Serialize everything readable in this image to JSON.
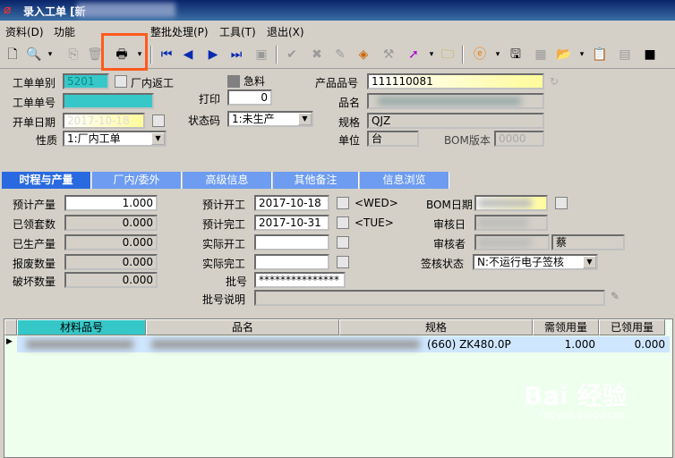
{
  "window": {
    "title": "录入工单 [新"
  },
  "menu": {
    "items": [
      "资料(D)",
      "功能",
      "整批处理(P)",
      "工具(T)",
      "退出(X)"
    ]
  },
  "toolbar": {
    "icons": [
      "new-icon",
      "preview-icon",
      "copy-icon",
      "delete-icon",
      "print-icon",
      "first-icon",
      "prev-icon",
      "next-icon",
      "last-icon",
      "query-icon",
      "approve-icon",
      "cancel-icon",
      "edit-icon",
      "erase-icon",
      "audit-icon",
      "transfer-icon",
      "folder-icon",
      "ie-icon",
      "save-icon",
      "calc-icon",
      "attach-icon",
      "paste-icon",
      "grid-icon",
      "stop-icon"
    ]
  },
  "form": {
    "order_type_label": "工单单别",
    "order_type_value": "5201",
    "internal_return_label": "厂内返工",
    "urgent_label": "急料",
    "product_no_label": "产品品号",
    "product_no_value": "111110081",
    "order_no_label": "工单单号",
    "print_label": "打印",
    "print_value": "0",
    "name_label": "品名",
    "open_date_label": "开单日期",
    "open_date_value": "2017-10-18",
    "status_label": "状态码",
    "status_value": "1:未生产",
    "spec_label": "规格",
    "spec_value": "QJZ",
    "nature_label": "性质",
    "nature_value": "1:厂内工单",
    "unit_label": "单位",
    "unit_value": "台",
    "bom_version_label": "BOM版本",
    "bom_version_value": "0000"
  },
  "tabs": [
    "时程与产量",
    "厂内/委外",
    "高级信息",
    "其他备注",
    "信息浏览"
  ],
  "schedule": {
    "planned_qty_label": "预计产量",
    "planned_qty_value": "1.000",
    "received_sets_label": "已领套数",
    "received_sets_value": "0.000",
    "produced_label": "已生产量",
    "produced_value": "0.000",
    "scrap_label": "报废数量",
    "scrap_value": "0.000",
    "damage_label": "破坏数量",
    "damage_value": "0.000",
    "plan_start_label": "预计开工",
    "plan_start_value": "2017-10-18",
    "plan_start_day": "<WED>",
    "plan_finish_label": "预计完工",
    "plan_finish_value": "2017-10-31",
    "plan_finish_day": "<TUE>",
    "actual_start_label": "实际开工",
    "actual_finish_label": "实际完工",
    "batch_label": "批号",
    "batch_value": "***************",
    "batch_desc_label": "批号说明",
    "bom_date_label": "BOM日期",
    "audit_date_label": "审核日",
    "auditor_label": "审核者",
    "auditor_value": "蔡",
    "sign_status_label": "签核状态",
    "sign_status_value": "N:不运行电子签核"
  },
  "grid": {
    "headers": [
      "材料品号",
      "品名",
      "规格",
      "需领用量",
      "已领用量"
    ],
    "rows": [
      {
        "spec": "(660) ZK480.0P",
        "required": "1.000",
        "received": "0.000"
      }
    ]
  },
  "watermark": {
    "text": "Bai 经验",
    "sub": "jingyan.baidu.com"
  }
}
